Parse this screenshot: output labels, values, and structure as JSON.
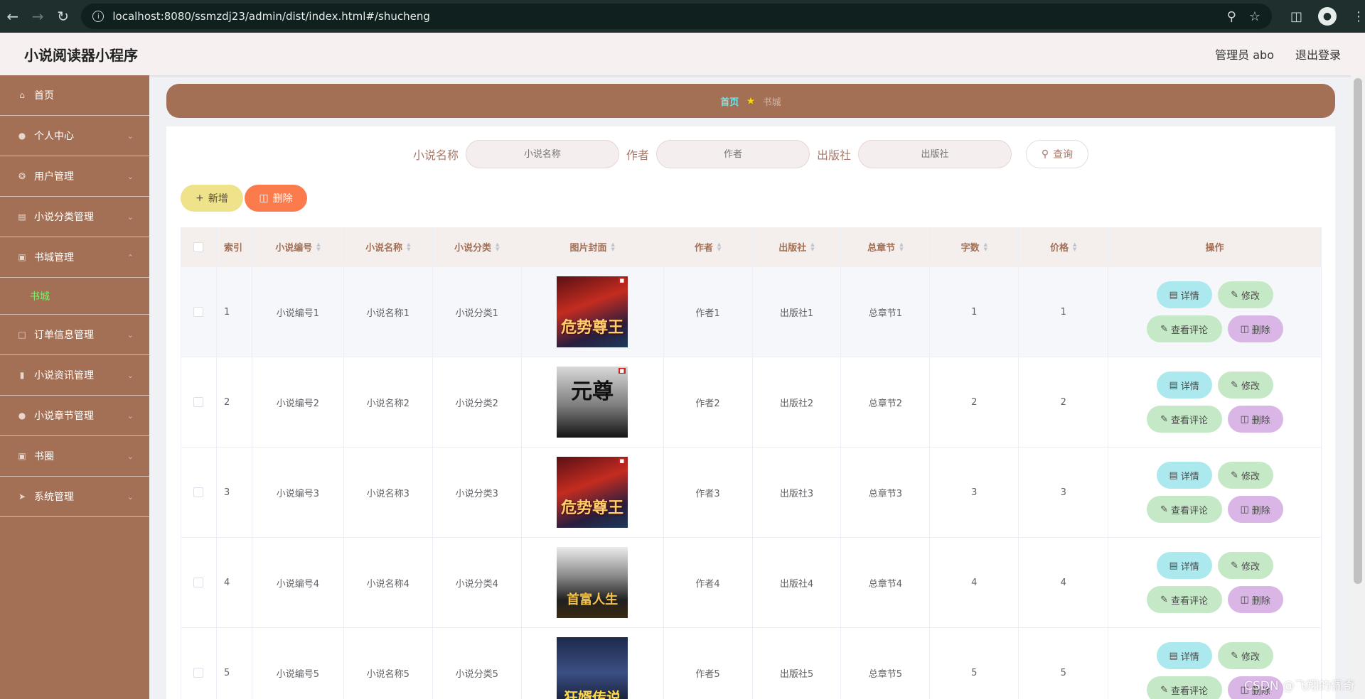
{
  "browser": {
    "url": "localhost:8080/ssmzdj23/admin/dist/index.html#/shucheng"
  },
  "header": {
    "title": "小说阅读器小程序",
    "user": "管理员 abo",
    "logout": "退出登录"
  },
  "sidebar": {
    "items": [
      {
        "label": "首页",
        "icon": "home-icon"
      },
      {
        "label": "个人中心",
        "icon": "user-icon"
      },
      {
        "label": "用户管理",
        "icon": "users-icon"
      },
      {
        "label": "小说分类管理",
        "icon": "category-icon"
      },
      {
        "label": "书城管理",
        "icon": "bookstore-icon"
      },
      {
        "label": "订单信息管理",
        "icon": "order-icon"
      },
      {
        "label": "小说资讯管理",
        "icon": "news-icon"
      },
      {
        "label": "小说章节管理",
        "icon": "chapter-icon"
      },
      {
        "label": "书圈",
        "icon": "circle-icon"
      },
      {
        "label": "系统管理",
        "icon": "system-icon"
      }
    ],
    "submenu": {
      "label": "书城"
    }
  },
  "breadcrumb": {
    "home": "首页",
    "current": "书城"
  },
  "search": {
    "name_label": "小说名称",
    "name_placeholder": "小说名称",
    "author_label": "作者",
    "author_placeholder": "作者",
    "publisher_label": "出版社",
    "publisher_placeholder": "出版社",
    "query": "查询"
  },
  "actions": {
    "add": "新增",
    "delete": "删除"
  },
  "table": {
    "headers": {
      "idx": "索引",
      "no": "小说编号",
      "name": "小说名称",
      "cat": "小说分类",
      "img": "图片封面",
      "author": "作者",
      "pub": "出版社",
      "ch": "总章节",
      "words": "字数",
      "price": "价格",
      "ops": "操作"
    },
    "rows": [
      {
        "idx": "1",
        "no": "小说编号1",
        "name": "小说名称1",
        "cat": "小说分类1",
        "cover": "危势尊王",
        "author": "作者1",
        "pub": "出版社1",
        "ch": "总章节1",
        "words": "1",
        "price": "1"
      },
      {
        "idx": "2",
        "no": "小说编号2",
        "name": "小说名称2",
        "cat": "小说分类2",
        "cover": "元尊",
        "author": "作者2",
        "pub": "出版社2",
        "ch": "总章节2",
        "words": "2",
        "price": "2"
      },
      {
        "idx": "3",
        "no": "小说编号3",
        "name": "小说名称3",
        "cat": "小说分类3",
        "cover": "危势尊王",
        "author": "作者3",
        "pub": "出版社3",
        "ch": "总章节3",
        "words": "3",
        "price": "3"
      },
      {
        "idx": "4",
        "no": "小说编号4",
        "name": "小说名称4",
        "cat": "小说分类4",
        "cover": "首富人生",
        "author": "作者4",
        "pub": "出版社4",
        "ch": "总章节4",
        "words": "4",
        "price": "4"
      },
      {
        "idx": "5",
        "no": "小说编号5",
        "name": "小说名称5",
        "cat": "小说分类5",
        "cover": "狂婿传说",
        "author": "作者5",
        "pub": "出版社5",
        "ch": "总章节5",
        "words": "5",
        "price": "5"
      }
    ],
    "ops": {
      "detail": "详情",
      "edit": "修改",
      "comment": "查看评论",
      "delete": "删除"
    }
  },
  "watermark": "CSDN @飞翔的佩奇",
  "colors": {
    "sidebar": "#a37055",
    "breadcrumb_home": "#71e4ea",
    "submenu_active": "#7ef06c"
  }
}
